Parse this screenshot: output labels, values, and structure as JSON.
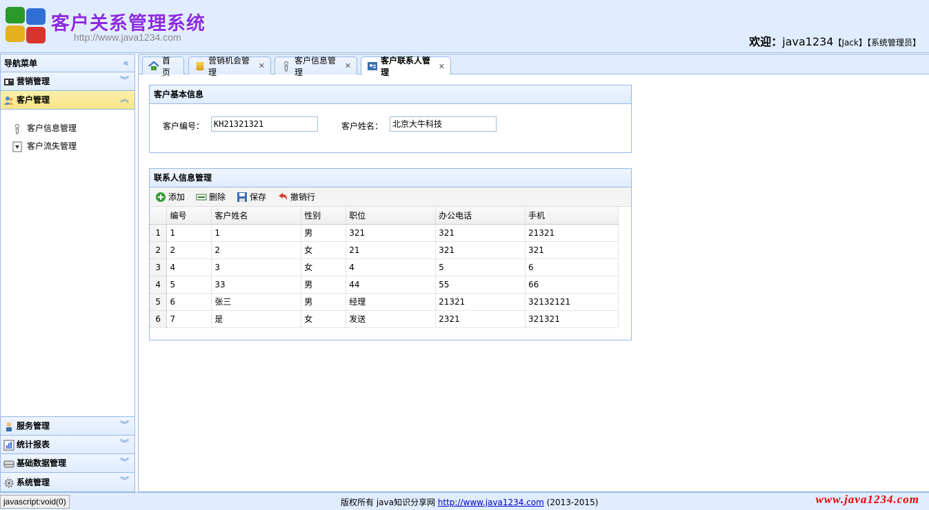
{
  "header": {
    "title": "客户关系管理系统",
    "site": "http://www.java1234.com",
    "welcome_label": "欢迎：",
    "username": "java1234",
    "real_name": "【Jack】",
    "role": "【系统管理员】"
  },
  "nav": {
    "title": "导航菜单",
    "collapse_icon": "«",
    "sections": [
      {
        "label": "营销管理",
        "icon": "sales-icon",
        "expanded": false
      },
      {
        "label": "客户管理",
        "icon": "customer-icon",
        "expanded": true
      },
      {
        "label": "服务管理",
        "icon": "service-icon",
        "expanded": false
      },
      {
        "label": "统计报表",
        "icon": "chart-icon",
        "expanded": false
      },
      {
        "label": "基础数据管理",
        "icon": "database-icon",
        "expanded": false
      },
      {
        "label": "系统管理",
        "icon": "settings-icon",
        "expanded": false
      }
    ],
    "customer_items": [
      {
        "label": "客户信息管理",
        "icon": "user-info-icon"
      },
      {
        "label": "客户流失管理",
        "icon": "customer-loss-icon"
      }
    ]
  },
  "tabs": [
    {
      "label": "首页",
      "icon": "home-icon",
      "closable": false
    },
    {
      "label": "营销机会管理",
      "icon": "coins-icon",
      "closable": true
    },
    {
      "label": "客户信息管理",
      "icon": "user-info-icon",
      "closable": true
    },
    {
      "label": "客户联系人管理",
      "icon": "contact-icon",
      "closable": true,
      "selected": true
    }
  ],
  "customer_info": {
    "title": "客户基本信息",
    "id_label": "客户编号：",
    "id_value": "KH21321321",
    "name_label": "客户姓名：",
    "name_value": "北京大牛科技"
  },
  "contacts": {
    "title": "联系人信息管理",
    "toolbar": {
      "add": "添加",
      "delete": "删除",
      "save": "保存",
      "undo": "撤销行"
    },
    "columns": [
      "编号",
      "客户姓名",
      "性别",
      "职位",
      "办公电话",
      "手机"
    ],
    "rows": [
      [
        "1",
        "1",
        "男",
        "321",
        "321",
        "21321"
      ],
      [
        "2",
        "2",
        "女",
        "21",
        "321",
        "321"
      ],
      [
        "4",
        "3",
        "女",
        "4",
        "5",
        "6"
      ],
      [
        "5",
        "33",
        "男",
        "44",
        "55",
        "66"
      ],
      [
        "6",
        "张三",
        "男",
        "经理",
        "21321",
        "32132121"
      ],
      [
        "7",
        "是",
        "女",
        "发送",
        "2321",
        "321321"
      ]
    ]
  },
  "footer": {
    "status": "javascript:void(0)",
    "copyright_prefix": "版权所有 java知识分享网 ",
    "link": "http://www.java1234.com",
    "years": " (2013-2015)",
    "watermark": "www.java1234.com"
  },
  "colors": {
    "border": "#95b8e7",
    "panel_bg": "#e0ecff",
    "active_section": "#f7e58a",
    "title": "#8a2be2",
    "watermark": "#e00000"
  }
}
